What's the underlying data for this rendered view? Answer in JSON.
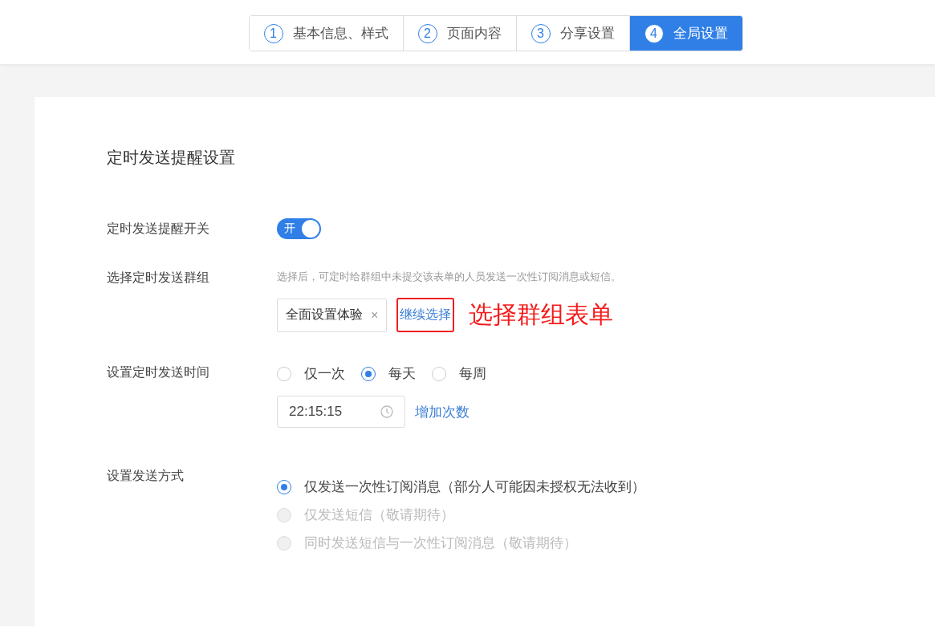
{
  "steps": [
    {
      "number": "1",
      "label": "基本信息、样式",
      "selected": false
    },
    {
      "number": "2",
      "label": "页面内容",
      "selected": false
    },
    {
      "number": "3",
      "label": "分享设置",
      "selected": false
    },
    {
      "number": "4",
      "label": "全局设置",
      "selected": true
    }
  ],
  "section_title": "定时发送提醒设置",
  "reminder_switch": {
    "label": "定时发送提醒开关",
    "on": true,
    "text": "开"
  },
  "group": {
    "label": "选择定时发送群组",
    "hint": "选择后，可定时给群组中未提交该表单的人员发送一次性订阅消息或短信。",
    "tag": "全面设置体验",
    "tag_close": "×",
    "link": "继续选择",
    "annotation": "选择群组表单"
  },
  "send_time": {
    "label": "设置定时发送时间",
    "options": [
      {
        "label": "仅一次",
        "selected": false
      },
      {
        "label": "每天",
        "selected": true
      },
      {
        "label": "每周",
        "selected": false
      }
    ],
    "time_value": "22:15:15",
    "add_link": "增加次数"
  },
  "send_method": {
    "label": "设置发送方式",
    "options": [
      {
        "label": "仅发送一次性订阅消息（部分人可能因未授权无法收到）",
        "selected": true,
        "disabled": false
      },
      {
        "label": "仅发送短信（敬请期待）",
        "selected": false,
        "disabled": true
      },
      {
        "label": "同时发送短信与一次性订阅消息（敬请期待）",
        "selected": false,
        "disabled": true
      }
    ]
  }
}
